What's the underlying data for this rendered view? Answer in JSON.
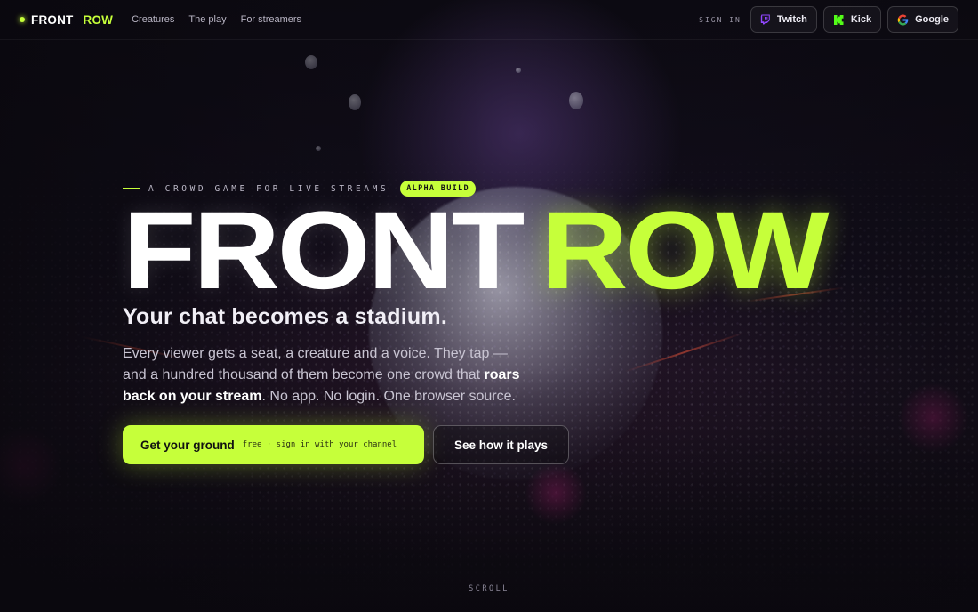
{
  "brand": {
    "name_part1": "FRONT",
    "name_part2": "ROW",
    "accent": "#c6ff3a"
  },
  "nav": {
    "links": [
      {
        "label": "Creatures"
      },
      {
        "label": "The play"
      },
      {
        "label": "For streamers"
      }
    ],
    "signin_label": "SIGN IN",
    "auth_buttons": [
      {
        "label": "Twitch",
        "icon": "twitch-icon",
        "color": "#9146ff"
      },
      {
        "label": "Kick",
        "icon": "kick-icon",
        "color": "#53fc18"
      },
      {
        "label": "Google",
        "icon": "google-icon",
        "color": "#4285f4"
      }
    ]
  },
  "hero": {
    "eyebrow": "A CROWD GAME FOR LIVE STREAMS",
    "badge": "ALPHA BUILD",
    "headline_part1": "FRONT",
    "headline_part2": "ROW",
    "tagline": "Your chat becomes a stadium.",
    "desc_part1": "Every viewer gets a seat, a creature and a voice. They tap — and a hundred thousand of them become one crowd that ",
    "desc_bold": "roars back on your stream",
    "desc_part2": ". No app. No login. One browser source.",
    "cta_primary_label": "Get your ground",
    "cta_primary_sub": "free · sign in with your channel",
    "cta_secondary_label": "See how it plays"
  },
  "scroll_hint": "SCROLL"
}
